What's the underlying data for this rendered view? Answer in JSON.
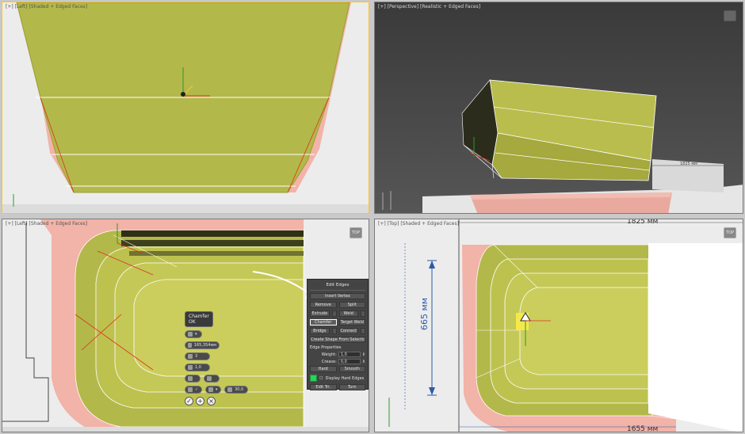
{
  "viewports": {
    "top_left": {
      "label": "[+] [Left] [Shaded + Edged Faces]"
    },
    "top_right": {
      "label": "[+] [Perspective] [Realistic + Edged Faces]",
      "dimension": "1825 мм"
    },
    "bottom_left": {
      "label": "[+] [Left] [Shaded + Edged Faces]"
    },
    "bottom_right": {
      "label": "[+] [Top] [Shaded + Edged Faces]",
      "dimension_top": "1825 мм",
      "dimension_side": "665 мм",
      "dimension_bottom": "1655 мм"
    }
  },
  "viewcube_label": "TOP",
  "caddy": {
    "title": "Chamfer",
    "subtitle": "OK",
    "amount": "165,354мм",
    "segments": "3",
    "tension": "1,0",
    "angle": "30,0"
  },
  "edit_edges": {
    "title": "Edit Edges",
    "insert_vertex": "Insert Vertex",
    "remove": "Remove",
    "split": "Split",
    "extrude": "Extrude",
    "weld": "Weld",
    "chamfer": "Chamfer",
    "target_weld": "Target Weld",
    "bridge": "Bridge",
    "connect": "Connect",
    "create_shape": "Create Shape From Selection",
    "edge_properties": "Edge Properties",
    "weight_label": "Weight:",
    "weight_value": "1,0",
    "crease_label": "Crease:",
    "crease_value": "0,0",
    "hard": "Hard",
    "smooth": "Smooth",
    "display_hard_edges": "Display Hard Edges",
    "edit_tri": "Edit Tri.",
    "turn": "Turn",
    "swatch_color": "#2bd15a"
  },
  "colors": {
    "mesh_fill": "#b3b84a",
    "mesh_edge": "#ffffff",
    "backing": "#f0a9a0",
    "selected_edge": "#e03020"
  }
}
